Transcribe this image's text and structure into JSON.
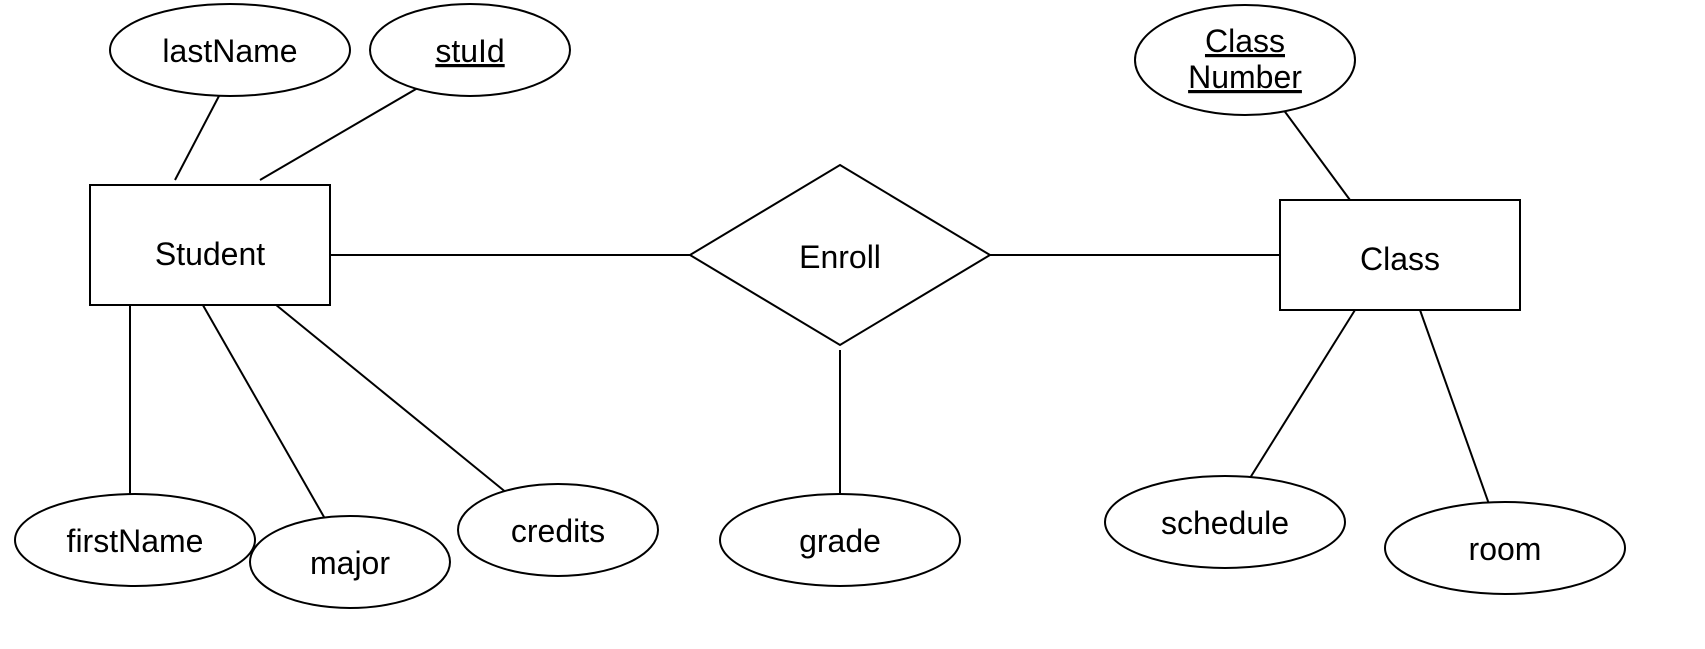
{
  "entities": {
    "student": {
      "label": "Student"
    },
    "class": {
      "label": "Class"
    }
  },
  "relationship": {
    "enroll": {
      "label": "Enroll"
    }
  },
  "attributes": {
    "lastName": {
      "label": "lastName",
      "key": false
    },
    "stuId": {
      "label": "stuId",
      "key": true
    },
    "firstName": {
      "label": "firstName",
      "key": false
    },
    "major": {
      "label": "major",
      "key": false
    },
    "credits": {
      "label": "credits",
      "key": false
    },
    "grade": {
      "label": "grade",
      "key": false
    },
    "classNumberLine1": {
      "label": "Class"
    },
    "classNumberLine2": {
      "label": "Number"
    },
    "schedule": {
      "label": "schedule",
      "key": false
    },
    "room": {
      "label": "room",
      "key": false
    }
  }
}
